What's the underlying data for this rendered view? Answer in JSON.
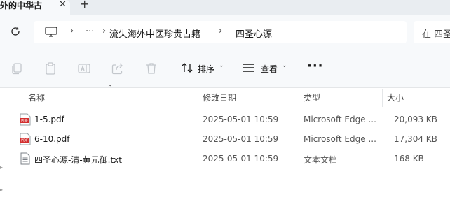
{
  "tab": {
    "title": "外的中华古",
    "close": "✕",
    "new": "+"
  },
  "address": {
    "ellipsis": "···",
    "crumbs": [
      "流失海外中医珍贵古籍",
      "四圣心源"
    ],
    "separator": "›"
  },
  "search": {
    "placeholder": "在 四圣"
  },
  "toolbar": {
    "sort_label": "排序",
    "view_label": "查看",
    "more_label": "···"
  },
  "columns": {
    "name": "名称",
    "modified": "修改日期",
    "type": "类型",
    "size": "大小"
  },
  "files": [
    {
      "icon": "pdf-icon",
      "name": "1-5.pdf",
      "modified": "2025-05-01 10:59",
      "type": "Microsoft Edge ...",
      "size": "20,093 KB"
    },
    {
      "icon": "pdf-icon",
      "name": "6-10.pdf",
      "modified": "2025-05-01 10:59",
      "type": "Microsoft Edge ...",
      "size": "17,304 KB"
    },
    {
      "icon": "text-file-icon",
      "name": "四圣心源-清-黄元御.txt",
      "modified": "2025-05-01 10:59",
      "type": "文本文档",
      "size": "168 KB"
    }
  ],
  "colors": {
    "accent": "#0067c0",
    "pdf_red": "#d32f2f",
    "bar_bg": "#f7f9fb"
  }
}
